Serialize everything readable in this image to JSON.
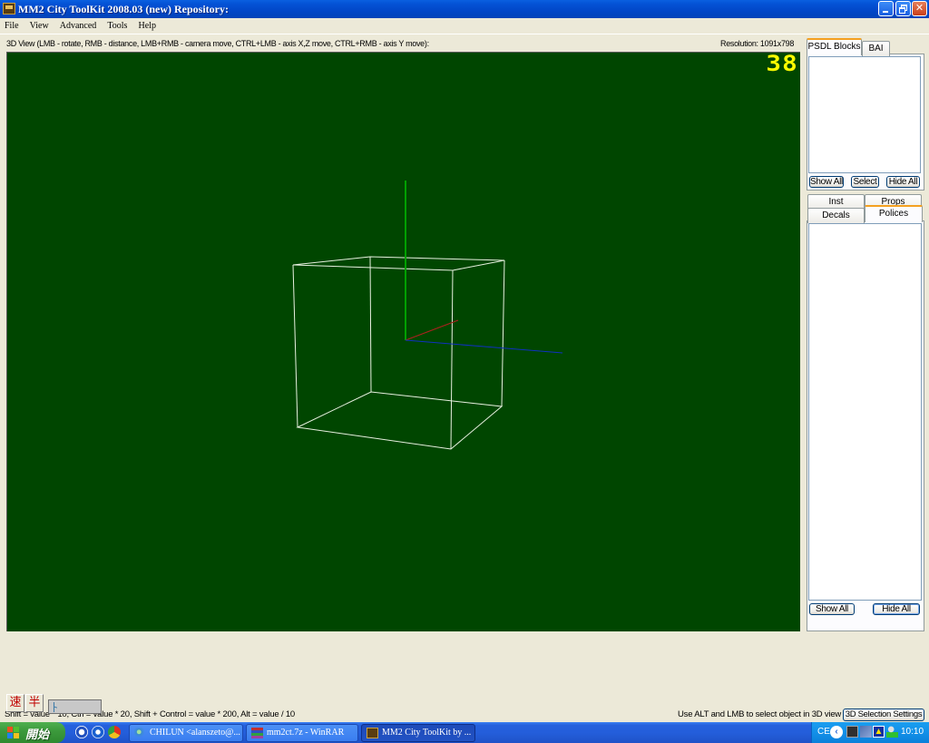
{
  "window": {
    "title": "MM2 City ToolKit 2008.03 (new) Repository:",
    "controls": {
      "minimize": "minimize",
      "maximize": "restore",
      "close": "close"
    }
  },
  "menu": [
    "File",
    "View",
    "Advanced",
    "Tools",
    "Help"
  ],
  "view3d": {
    "caption": "3D View (LMB - rotate, RMB - distance, LMB+RMB - camera move, CTRL+LMB - axis X,Z move, CTRL+RMB - axis Y move):",
    "resolution": "Resolution: 1091x798",
    "fps": "38",
    "background_color": "#004600",
    "axis_colors": {
      "x": "#b02020",
      "y": "#00a000",
      "z": "#1030c0"
    },
    "wireframe_color": "#e8f0e0"
  },
  "psdl_panel": {
    "tabs": [
      "PSDL Blocks",
      "BAI"
    ],
    "active_tab": "PSDL Blocks",
    "buttons": {
      "show_all": "Show All",
      "select": "Select",
      "hide_all": "Hide All"
    }
  },
  "objects_panel": {
    "tabs_row1": [
      "Inst",
      "Props"
    ],
    "tabs_row2": [
      "Decals",
      "Polices"
    ],
    "active_tab": "Polices",
    "buttons": {
      "show_all": "Show All",
      "hide_all": "Hide All"
    }
  },
  "status": {
    "hint": "Shift = value * 10, Ctrl = value * 20, Shift + Control = value * 200, Alt = value / 10",
    "alt_hint": "Use ALT and LMB to select object in 3D view",
    "selection_settings_button": "3D Selection Settings"
  },
  "ime": {
    "mode1": "速",
    "mode2": "半"
  },
  "taskbar": {
    "start_label": "開始",
    "quick_launch": [
      "ccleaner-icon",
      "media-player-icon",
      "chrome-icon"
    ],
    "tasks": [
      {
        "label": "CHILUN <alanszeto@...",
        "icon": "messenger-icon",
        "active": false
      },
      {
        "label": "mm2ct.7z - WinRAR",
        "icon": "winrar-icon",
        "active": false
      },
      {
        "label": "MM2 City ToolKit by ...",
        "icon": "mm2-icon",
        "active": true
      }
    ],
    "tray": {
      "lang": "CE",
      "clock": "10:10"
    }
  }
}
